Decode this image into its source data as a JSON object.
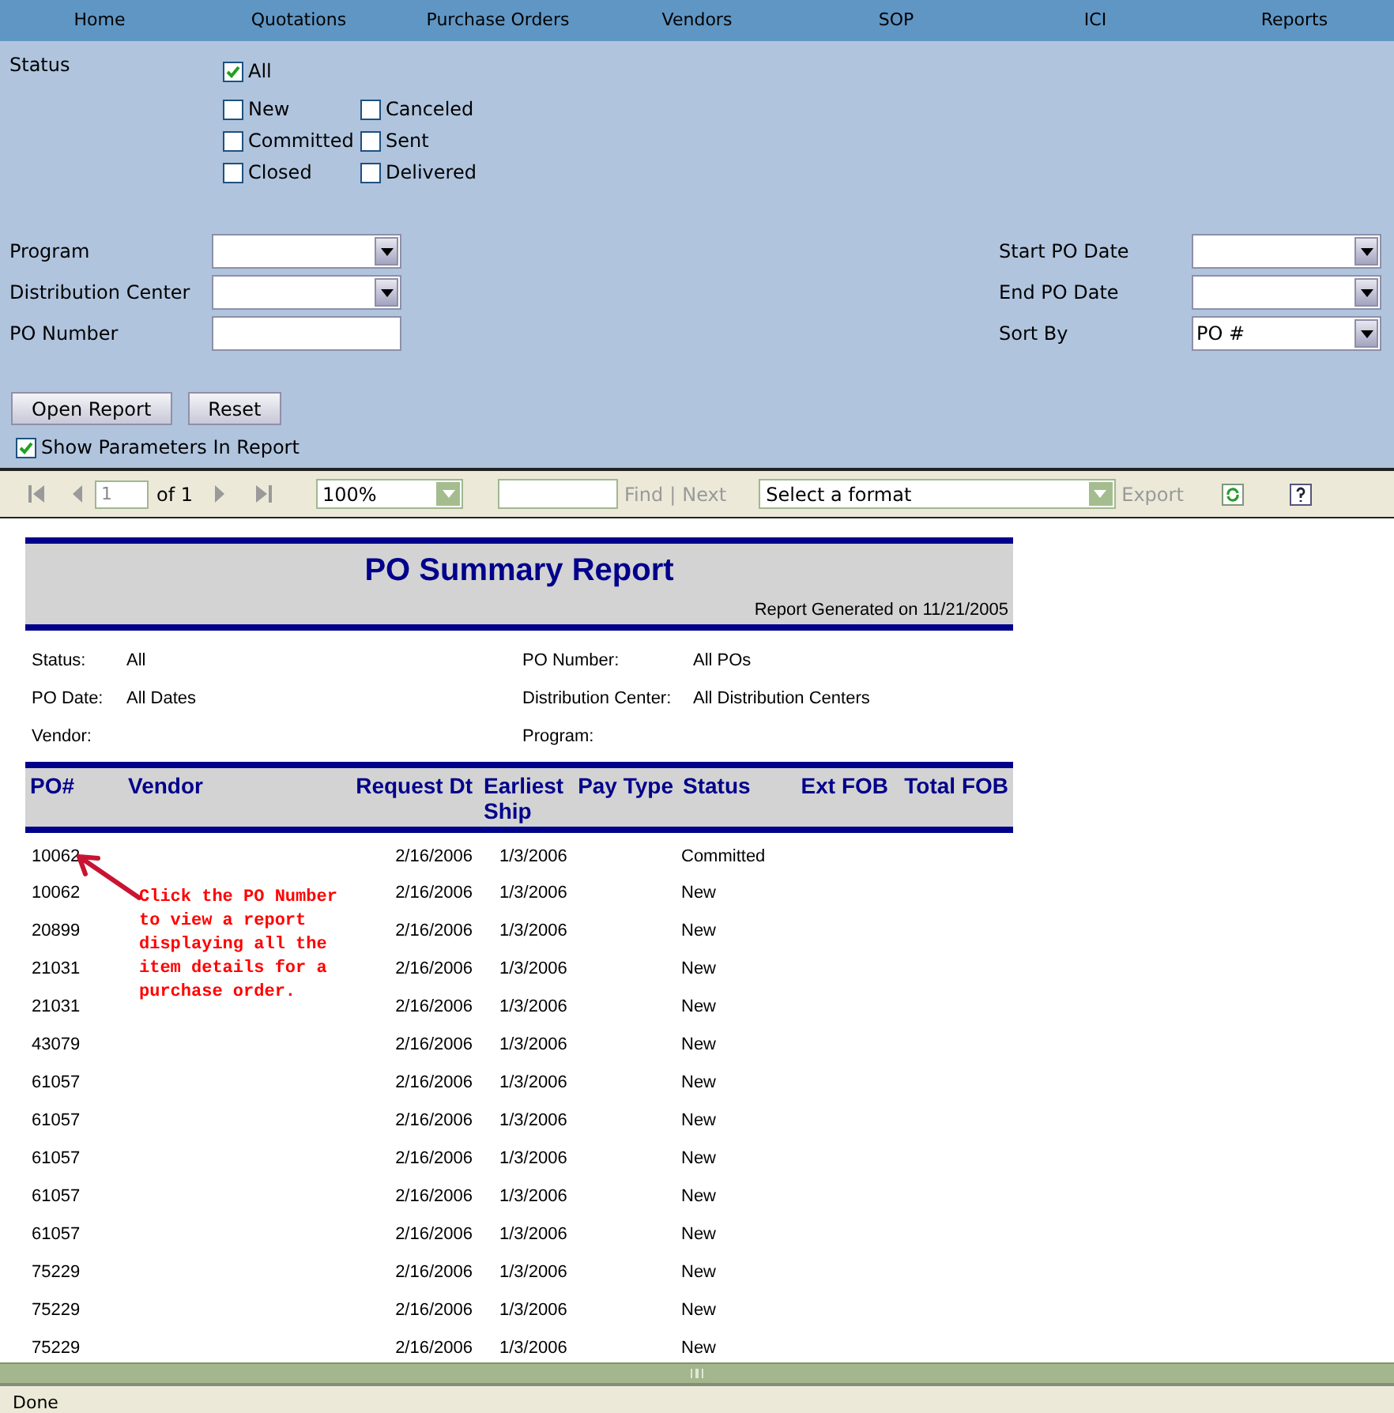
{
  "nav": [
    {
      "label": "Home"
    },
    {
      "label": "Quotations"
    },
    {
      "label": "Purchase Orders"
    },
    {
      "label": "Vendors"
    },
    {
      "label": "SOP"
    },
    {
      "label": "ICI"
    },
    {
      "label": "Reports"
    }
  ],
  "status_filter": {
    "label": "Status",
    "all": {
      "label": "All",
      "checked": true
    },
    "options": [
      {
        "label": "New",
        "checked": false
      },
      {
        "label": "Canceled",
        "checked": false
      },
      {
        "label": "Committed",
        "checked": false
      },
      {
        "label": "Sent",
        "checked": false
      },
      {
        "label": "Closed",
        "checked": false
      },
      {
        "label": "Delivered",
        "checked": false
      }
    ]
  },
  "left_fields": [
    {
      "label": "Program",
      "kind": "dropdown"
    },
    {
      "label": "Distribution Center",
      "kind": "dropdown"
    },
    {
      "label": "PO Number",
      "kind": "text"
    }
  ],
  "right_fields": [
    {
      "label": "Start PO Date",
      "kind": "dropdown"
    },
    {
      "label": "End PO Date",
      "kind": "dropdown"
    },
    {
      "label": "Sort By",
      "kind": "dropdown",
      "value": "PO #"
    }
  ],
  "buttons": [
    "Open Report",
    "Reset"
  ],
  "show_parameters": {
    "label": "Show Parameters In Report",
    "checked": true
  },
  "toolbar": {
    "page": "1",
    "of": "of 1",
    "zoom": "100%",
    "find": "Find",
    "separator": "|",
    "next": "Next",
    "format": "Select a format",
    "export": "Export"
  },
  "report": {
    "title": "PO Summary Report",
    "generated": "Report Generated on 11/21/2005",
    "params_left": [
      {
        "label": "Status:",
        "value": "All"
      },
      {
        "label": "PO Date:",
        "value": "All Dates"
      },
      {
        "label": "Vendor:"
      }
    ],
    "params_right": [
      {
        "label": "PO Number:",
        "value": "All POs"
      },
      {
        "label": "Distribution Center:",
        "value": "All Distribution Centers"
      },
      {
        "label": "Program:"
      }
    ],
    "columns": [
      "PO#",
      "Vendor",
      "Request Dt",
      "Earliest Ship",
      "Pay Type",
      "Status",
      "Ext FOB",
      "Total FOB"
    ],
    "rows": [
      {
        "po": "10062",
        "request_dt": "2/16/2006",
        "earliest_ship": "1/3/2006",
        "status": "Committed"
      },
      {
        "po": "10062",
        "request_dt": "2/16/2006",
        "earliest_ship": "1/3/2006",
        "status": "New"
      },
      {
        "po": "20899",
        "request_dt": "2/16/2006",
        "earliest_ship": "1/3/2006",
        "status": "New"
      },
      {
        "po": "21031",
        "request_dt": "2/16/2006",
        "earliest_ship": "1/3/2006",
        "status": "New"
      },
      {
        "po": "21031",
        "request_dt": "2/16/2006",
        "earliest_ship": "1/3/2006",
        "status": "New"
      },
      {
        "po": "43079",
        "request_dt": "2/16/2006",
        "earliest_ship": "1/3/2006",
        "status": "New"
      },
      {
        "po": "61057",
        "request_dt": "2/16/2006",
        "earliest_ship": "1/3/2006",
        "status": "New"
      },
      {
        "po": "61057",
        "request_dt": "2/16/2006",
        "earliest_ship": "1/3/2006",
        "status": "New"
      },
      {
        "po": "61057",
        "request_dt": "2/16/2006",
        "earliest_ship": "1/3/2006",
        "status": "New"
      },
      {
        "po": "61057",
        "request_dt": "2/16/2006",
        "earliest_ship": "1/3/2006",
        "status": "New"
      },
      {
        "po": "61057",
        "request_dt": "2/16/2006",
        "earliest_ship": "1/3/2006",
        "status": "New"
      },
      {
        "po": "75229",
        "request_dt": "2/16/2006",
        "earliest_ship": "1/3/2006",
        "status": "New"
      },
      {
        "po": "75229",
        "request_dt": "2/16/2006",
        "earliest_ship": "1/3/2006",
        "status": "New"
      },
      {
        "po": "75229",
        "request_dt": "2/16/2006",
        "earliest_ship": "1/3/2006",
        "status": "New"
      }
    ],
    "callout": "Click the PO Number to view a report displaying all the item details for a purchase order."
  },
  "status_bar": "Done"
}
